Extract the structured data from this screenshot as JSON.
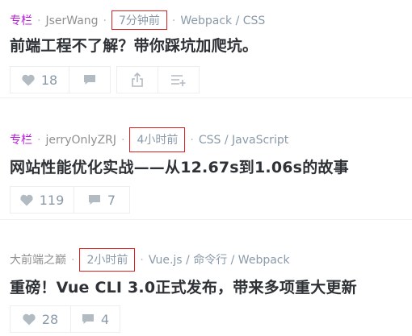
{
  "entries": [
    {
      "category": "专栏",
      "author": "JserWang",
      "time": "7分钟前",
      "tags": "Webpack / CSS",
      "title": "前端工程不了解？带你踩坑加爬坑。",
      "likes": "18",
      "comments": ""
    },
    {
      "category": "专栏",
      "author": "jerryOnlyZRJ",
      "time": "4小时前",
      "tags": "CSS / JavaScript",
      "title": "网站性能优化实战——从12.67s到1.06s的故事",
      "likes": "119",
      "comments": "7"
    },
    {
      "category": "",
      "author": "大前端之巅",
      "time": "2小时前",
      "tags": "Vue.js / 命令行 / Webpack",
      "title": "重磅！Vue CLI 3.0正式发布，带来多项重大更新",
      "likes": "28",
      "comments": "4"
    }
  ],
  "icons": {
    "like": "heart-icon",
    "comment": "comment-icon",
    "share": "share-icon",
    "collect": "add-to-collection-icon"
  },
  "colors": {
    "category": "#b71ed7",
    "highlight_box": "#e02020",
    "meta_text": "#8a9aa9",
    "title_text": "#2e3135"
  }
}
